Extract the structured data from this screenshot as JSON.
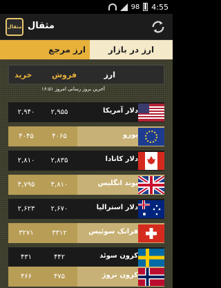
{
  "status": {
    "battery": "98",
    "time": "4:55"
  },
  "app": {
    "title": "مثقال",
    "logo_text": "مثقال"
  },
  "tabs": {
    "market": "ارز در بازار",
    "reference": "ارز مرجع"
  },
  "table": {
    "headers": {
      "name": "ارز",
      "sell": "فروش",
      "buy": "خرید"
    },
    "updated": "آخرین بروز رسانی امروز ۱۶:۵۱",
    "rows": [
      {
        "name": "دلار آمریکا",
        "sell": "۲,۹۵۵",
        "buy": "۲,۹۴۰",
        "flag": "us-flag-icon"
      },
      {
        "name": "یورو",
        "sell": "۴۰۶۵",
        "buy": "۴۰۴۵",
        "flag": "eu-flag-icon"
      },
      {
        "name": "دلار کانادا",
        "sell": "۲,۸۳۵",
        "buy": "۲,۸۱۰",
        "flag": "canada-flag-icon"
      },
      {
        "name": "پوند انگلیس",
        "sell": "۴,۸۱۰",
        "buy": "۴,۷۹۵",
        "flag": "uk-flag-icon"
      },
      {
        "name": "دلار استرالیا",
        "sell": "۲,۶۷۰",
        "buy": "۲,۶۲۳",
        "flag": "australia-flag-icon"
      },
      {
        "name": "فرانک سوئیس",
        "sell": "۳۳۱۲",
        "buy": "۳۲۷۱",
        "flag": "swiss-flag-icon"
      },
      {
        "name": "کرون سوئد",
        "sell": "۴۴۲",
        "buy": "۴۳۱",
        "flag": "sweden-flag-icon"
      },
      {
        "name": "کرون نروژ",
        "sell": "۴۷۵",
        "buy": "۴۶۶",
        "flag": "norway-flag-icon"
      }
    ]
  }
}
